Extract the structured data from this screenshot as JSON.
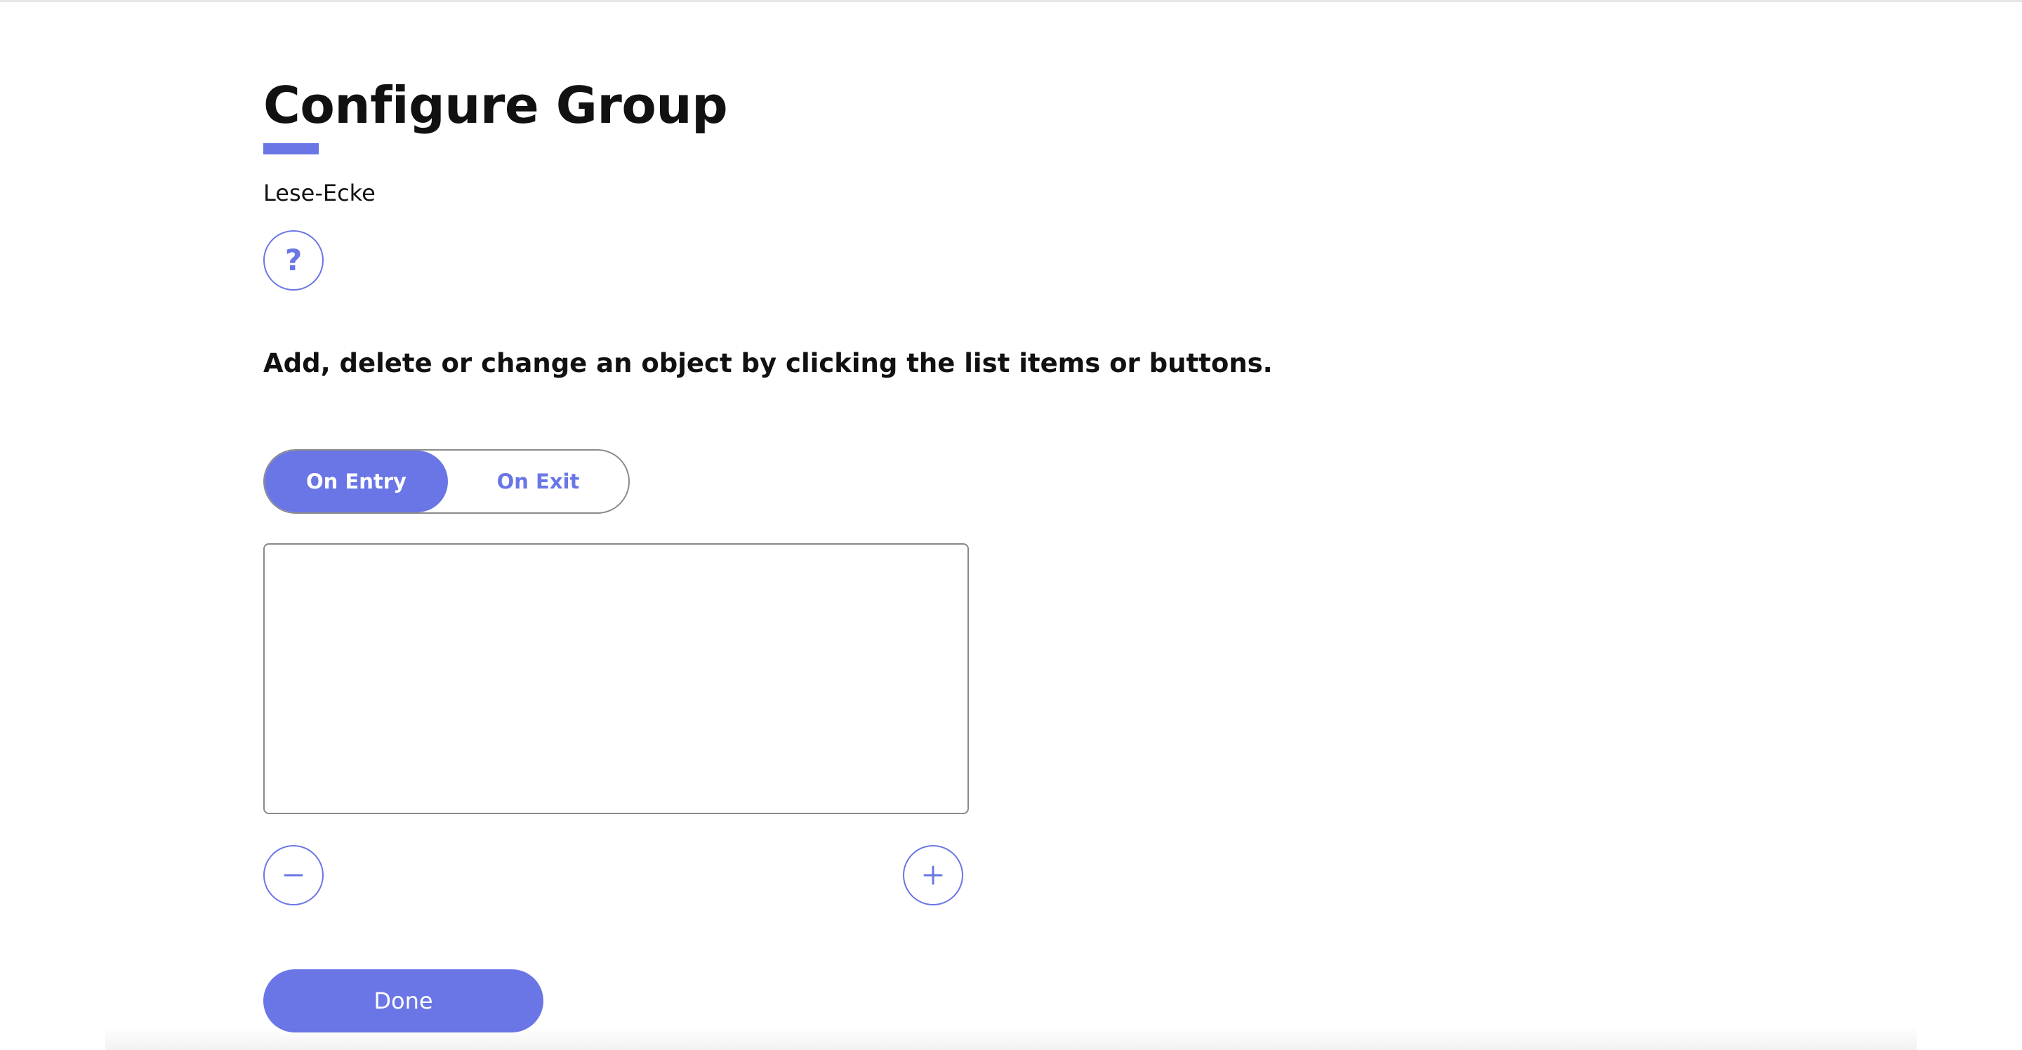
{
  "page": {
    "title": "Configure Group",
    "group_name": "Lese-Ecke",
    "instructions": "Add, delete or change an object by clicking the list items or buttons."
  },
  "tabs": [
    {
      "label": "On Entry",
      "selected": true
    },
    {
      "label": "On Exit",
      "selected": false
    }
  ],
  "list": {
    "items": []
  },
  "buttons": {
    "help_icon": "question-mark",
    "remove_icon": "minus",
    "add_icon": "plus",
    "done_label": "Done"
  },
  "colors": {
    "accent": "#6a76e6",
    "text": "#111111",
    "border": "#8a8a8a"
  }
}
